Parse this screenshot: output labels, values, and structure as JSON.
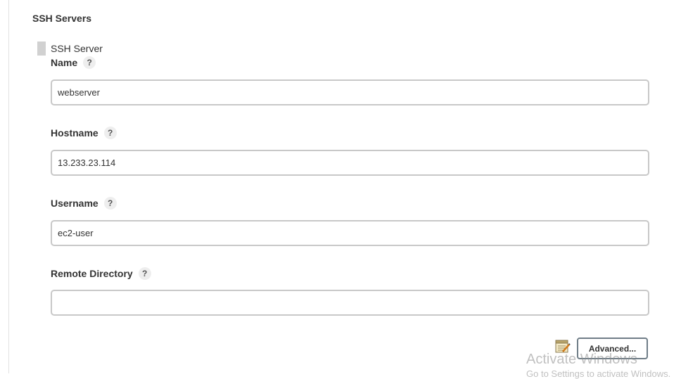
{
  "section": {
    "title": "SSH Servers"
  },
  "server": {
    "label": "SSH Server",
    "fields": [
      {
        "label": "Name",
        "help": "?",
        "value": "webserver"
      },
      {
        "label": "Hostname",
        "help": "?",
        "value": "13.233.23.114"
      },
      {
        "label": "Username",
        "help": "?",
        "value": "ec2-user"
      },
      {
        "label": "Remote Directory",
        "help": "?",
        "value": ""
      }
    ],
    "advanced_label": "Advanced...",
    "advanced_icon": "notepad-icon"
  },
  "watermark": {
    "title": "Activate Windows",
    "subtitle": "Go to Settings to activate Windows."
  }
}
